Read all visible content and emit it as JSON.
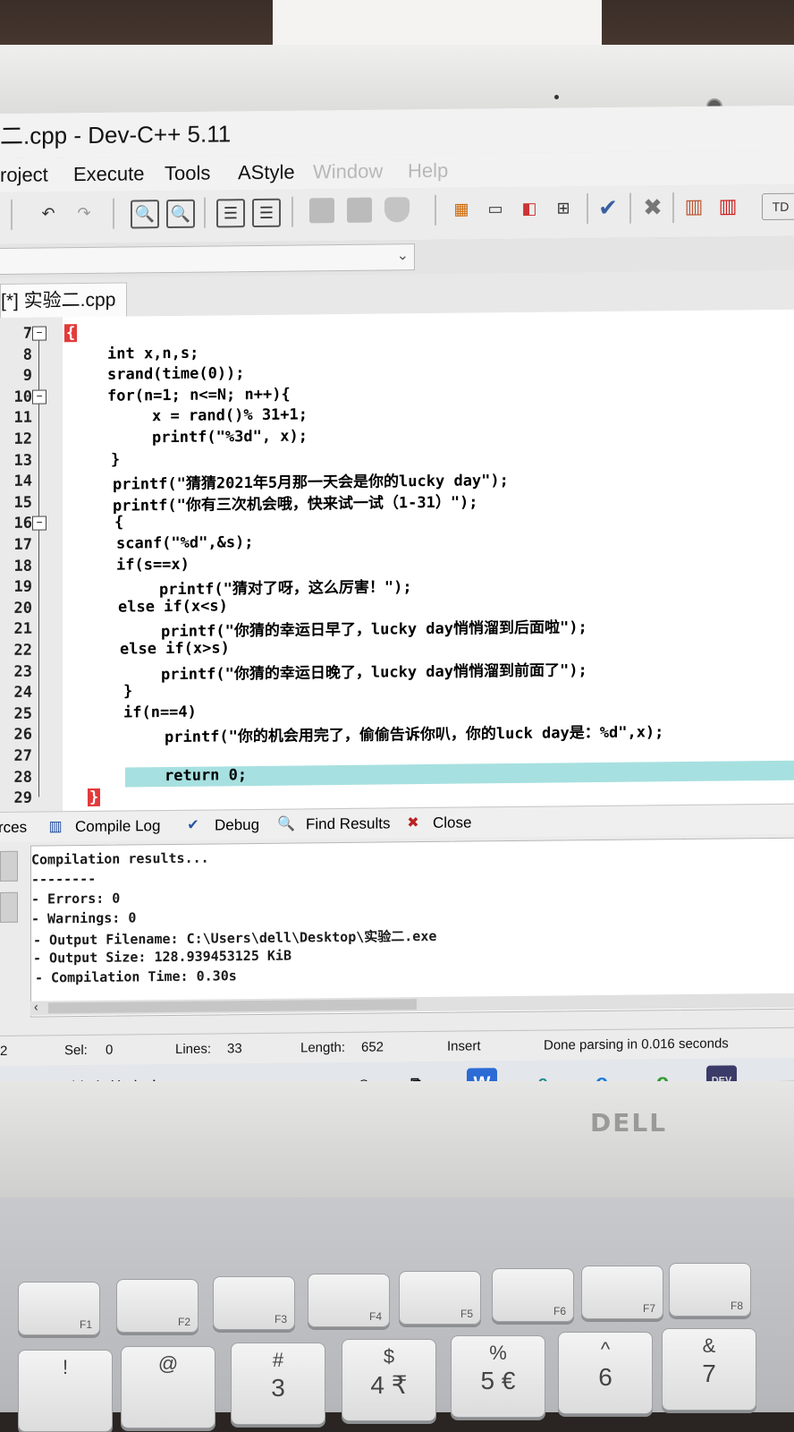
{
  "window": {
    "title": "二.cpp - Dev-C++ 5.11"
  },
  "menu": [
    "roject",
    "Execute",
    "Tools",
    "AStyle",
    "Window",
    "Help"
  ],
  "editor_tab": "[*] 实验二.cpp",
  "code_lines": [
    {
      "n": "7",
      "text": "{"
    },
    {
      "n": "8",
      "text": "int x,n,s;"
    },
    {
      "n": "9",
      "text": "srand(time(0));"
    },
    {
      "n": "10",
      "text": "for(n=1; n<=N; n++){"
    },
    {
      "n": "11",
      "text": "x = rand()% 31+1;"
    },
    {
      "n": "12",
      "text": "printf(\"%3d\", x);"
    },
    {
      "n": "13",
      "text": "}"
    },
    {
      "n": "14",
      "text": "printf(\"猜猜2021年5月那一天会是你的lucky day\");"
    },
    {
      "n": "15",
      "text": "printf(\"你有三次机会哦，快来试一试（1-31）\");"
    },
    {
      "n": "16",
      "text": "{"
    },
    {
      "n": "17",
      "text": "scanf(\"%d\",&s);"
    },
    {
      "n": "18",
      "text": "if(s==x)"
    },
    {
      "n": "19",
      "text": "printf(\"猜对了呀，这么厉害！\");"
    },
    {
      "n": "20",
      "text": "else if(x<s)"
    },
    {
      "n": "21",
      "text": "printf(\"你猜的幸运日早了，lucky day悄悄溜到后面啦\");"
    },
    {
      "n": "22",
      "text": "else if(x>s)"
    },
    {
      "n": "23",
      "text": "printf(\"你猜的幸运日晚了，lucky day悄悄溜到前面了\");"
    },
    {
      "n": "24",
      "text": "}"
    },
    {
      "n": "25",
      "text": "if(n==4)"
    },
    {
      "n": "26",
      "text": "printf(\"你的机会用完了，偷偷告诉你叭，你的luck day是：%d\",x);"
    },
    {
      "n": "27",
      "text": ""
    },
    {
      "n": "28",
      "text": "return 0;"
    },
    {
      "n": "29",
      "text": "}"
    }
  ],
  "bottom_tabs": {
    "resources": "rces",
    "compile_log": "Compile Log",
    "debug": "Debug",
    "find_results": "Find Results",
    "close": "Close"
  },
  "compile_log": [
    "Compilation results...",
    "--------",
    "- Errors: 0",
    "- Warnings: 0",
    "- Output Filename: C:\\Users\\dell\\Desktop\\实验二.exe",
    "- Output Size: 128.939453125 KiB",
    "- Compilation Time: 0.30s"
  ],
  "status": {
    "col": "2",
    "sel_label": "Sel:",
    "sel": "0",
    "lines_label": "Lines:",
    "lines": "33",
    "length_label": "Length:",
    "length": "652",
    "mode": "Insert",
    "message": "Done parsing in 0.016 seconds"
  },
  "taskbar": {
    "search_placeholder": "键入你要搜索的内容"
  },
  "brand": "DELL",
  "keys_fn": [
    "F1",
    "F2",
    "F3",
    "F4",
    "F5",
    "F6",
    "F7",
    "F8"
  ],
  "keys_num": [
    "!",
    "@",
    "#",
    "$",
    "%",
    "^",
    "&"
  ],
  "keys_num_sub": [
    "",
    "",
    "3",
    "4 ₹",
    "5 €",
    "6",
    "7"
  ],
  "colors": {
    "string": "#1c3fc0",
    "number": "#7a0f0f",
    "current_line": "#a7e0e0"
  }
}
